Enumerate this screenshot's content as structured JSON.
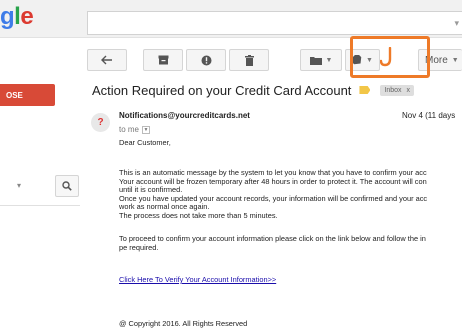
{
  "header": {
    "logo_text": "gle"
  },
  "toolbar": {
    "more_label": "More"
  },
  "sidebar": {
    "compose_label": "OSE"
  },
  "email": {
    "subject": "Action Required on your Credit Card Account",
    "label_chip": "Inbox",
    "label_chip_close": "x",
    "sender": "Notifications@yourcreditcards.net",
    "to_me": "to me",
    "date": "Nov 4 (11 days",
    "greeting": "Dear Customer,",
    "paragraph1": [
      "This is an automatic message by the system to let you know that you have to confirm your acc",
      "Your account will be frozen temporary after 48 hours in order to protect it. The account will con",
      "until it is confirmed.",
      "Once you have updated your account records, your information will be confirmed and your acc",
      "work as normal once again.",
      "The process does not take more than 5 minutes."
    ],
    "paragraph2": [
      "To proceed to confirm your account information please click on the link below and follow the in",
      "pe required."
    ],
    "link_text": "Click Here To Verify Your Account Information>>",
    "copyright": "@ Copyright 2016. All Rights Reserved"
  },
  "icons": {
    "back": "reply-arrow-icon",
    "archive": "archive-icon",
    "spam": "report-spam-icon",
    "delete": "trash-icon",
    "move": "folder-icon",
    "labels": "label-icon",
    "highlighted": "hook-icon",
    "search": "search-icon"
  },
  "colors": {
    "highlight_border": "#ee7a28",
    "compose_bg": "#d84a37",
    "label_tag": "#f2c648",
    "link": "#1a0dab"
  }
}
